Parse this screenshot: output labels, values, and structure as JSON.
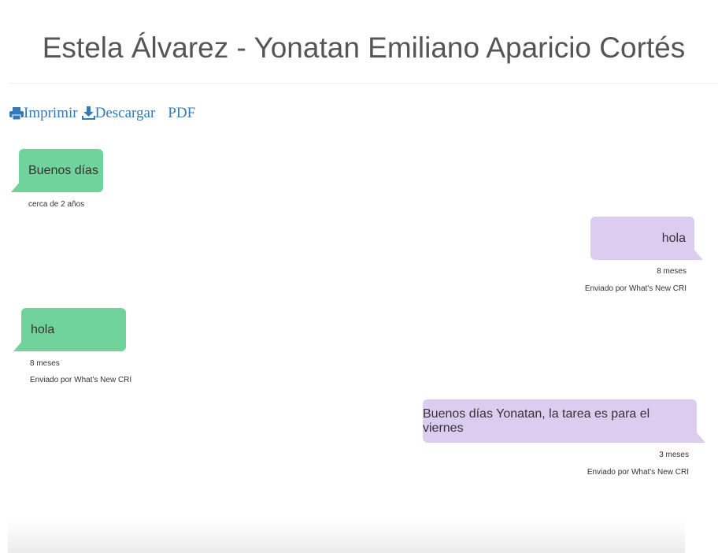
{
  "header": {
    "title": "Estela Álvarez - Yonatan Emiliano Aparicio Cortés"
  },
  "toolbar": {
    "print_label": "Imprimir",
    "download_label": "Descargar",
    "pdf_label": "PDF"
  },
  "colors": {
    "incoming": "#6fd39b",
    "outgoing": "#dccdf0",
    "link": "#337ab7"
  },
  "messages": [
    {
      "direction": "incoming",
      "text": "Buenos días",
      "time": "cerca de 2 años"
    },
    {
      "direction": "outgoing",
      "text": "hola",
      "time": "8 meses",
      "sent_by": "Enviado por What's New CRI"
    },
    {
      "direction": "incoming",
      "text": "hola",
      "time": "8 meses",
      "sent_by": "Enviado por What's New CRI"
    },
    {
      "direction": "outgoing",
      "text": "Buenos días Yonatan, la tarea es para el viernes",
      "time": "3 meses",
      "sent_by": "Enviado por What's New CRI"
    }
  ]
}
